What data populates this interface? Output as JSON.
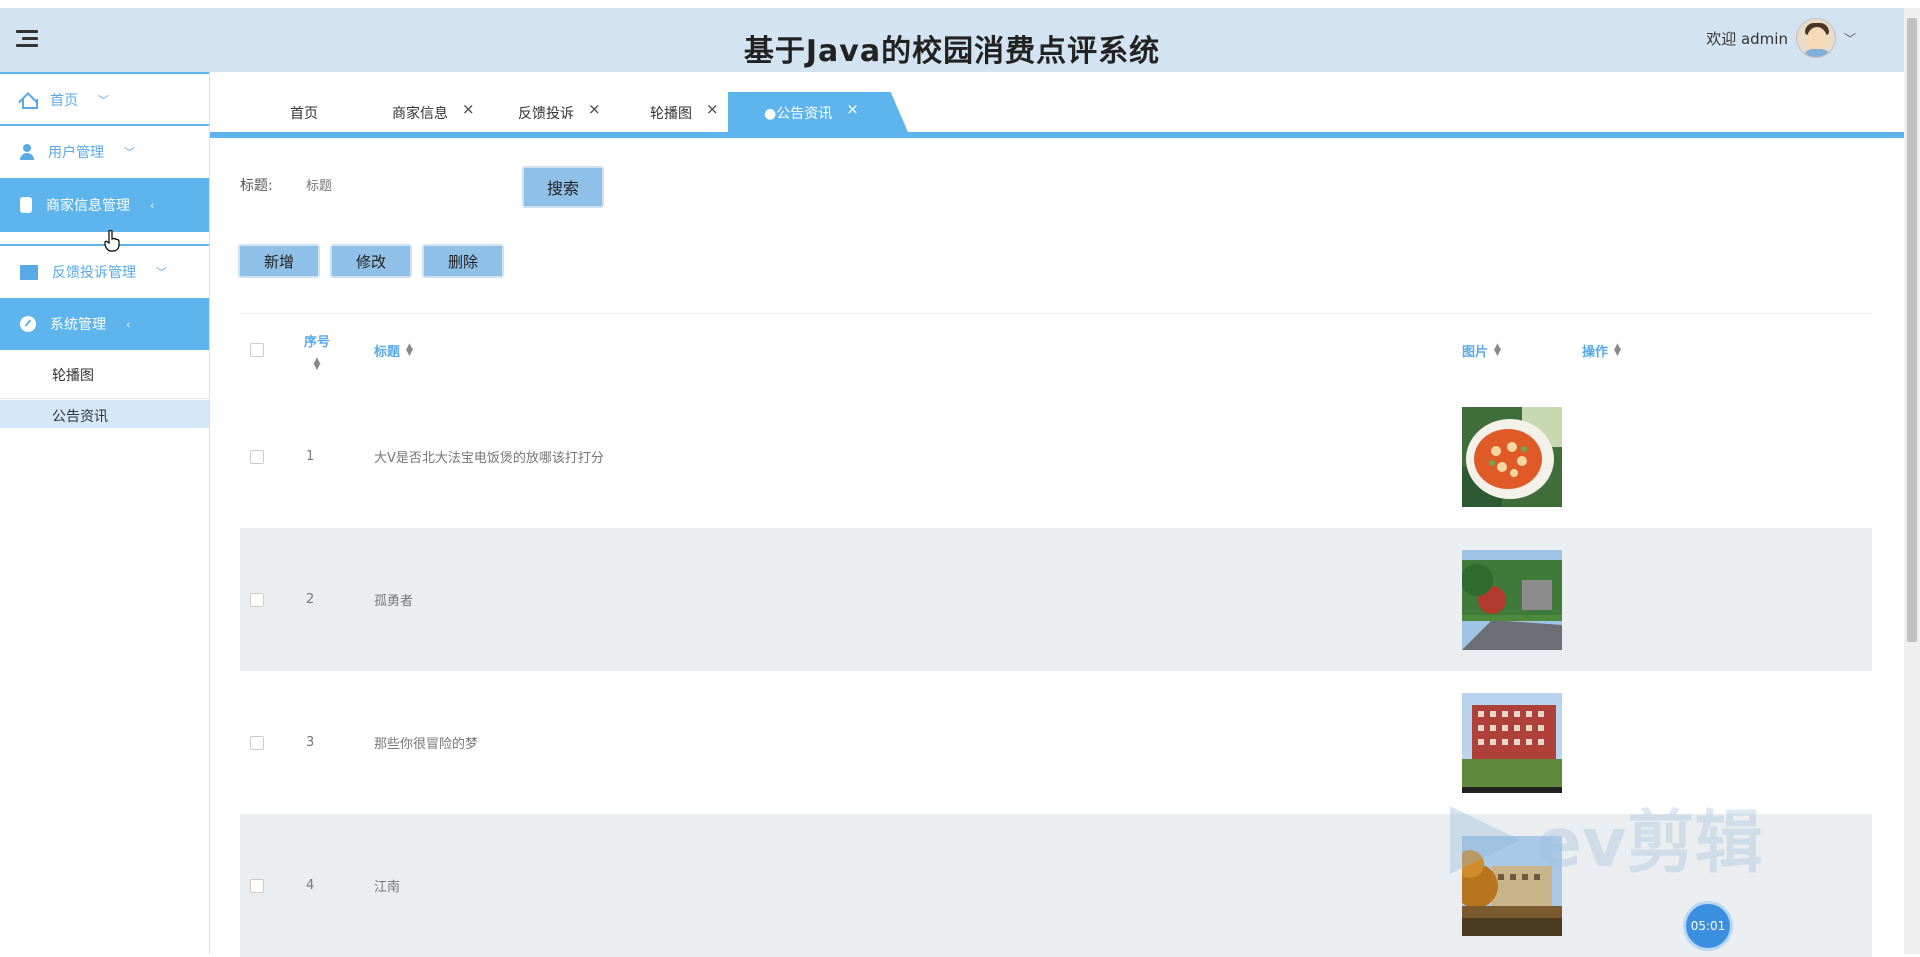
{
  "header": {
    "title": "基于Java的校园消费点评系统",
    "welcome": "欢迎 admin"
  },
  "sidebar": {
    "items": [
      {
        "label": "首页",
        "caret": "﹀"
      },
      {
        "label": "用户管理",
        "caret": "﹀"
      },
      {
        "label": "商家信息管理",
        "caret": "‹"
      },
      {
        "label": "反馈投诉管理",
        "caret": "﹀"
      },
      {
        "label": "系统管理",
        "caret": "‹"
      }
    ],
    "sub_items": [
      {
        "label": "轮播图"
      },
      {
        "label": "公告资讯"
      }
    ]
  },
  "tabs": [
    {
      "label": "首页"
    },
    {
      "label": "商家信息",
      "close": "×"
    },
    {
      "label": "反馈投诉",
      "close": "×"
    },
    {
      "label": "轮播图",
      "close": "×"
    },
    {
      "label": "●公告资讯",
      "close": "×"
    }
  ],
  "search": {
    "label": "标题:",
    "placeholder": "标题",
    "button": "搜索"
  },
  "actions": {
    "add": "新增",
    "edit": "修改",
    "delete": "删除"
  },
  "table": {
    "columns": {
      "index": "序号",
      "title": "标题",
      "image": "图片",
      "ops": "操作"
    },
    "rows": [
      {
        "index": "1",
        "title": "大V是否北大法宝电饭煲的放哪该打打分",
        "image": "food-photo"
      },
      {
        "index": "2",
        "title": "孤勇者",
        "image": "campus-road-photo"
      },
      {
        "index": "3",
        "title": "那些你很冒险的梦",
        "image": "red-building-photo"
      },
      {
        "index": "4",
        "title": "江南",
        "image": "campus-autumn-photo"
      }
    ]
  },
  "overlay": {
    "timer": "05:01"
  },
  "colors": {
    "accent": "#5eb5ee",
    "header_bg": "#d4e3f2",
    "button_bg": "#8ec0e8"
  }
}
